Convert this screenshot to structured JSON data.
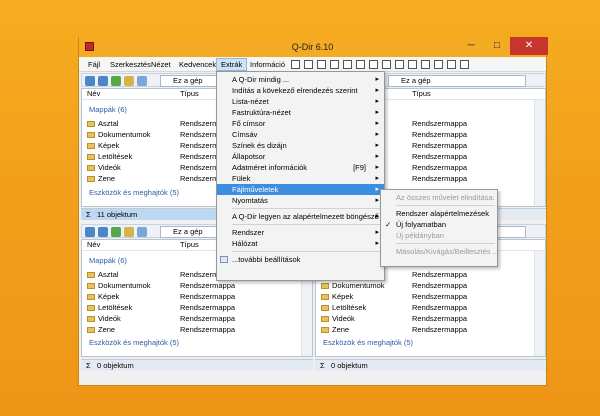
{
  "window": {
    "title": "Q-Dir 6.10"
  },
  "menubar": [
    "Fájl",
    "Szerkesztés",
    "Nézet",
    "Kedvencek",
    "Extrák",
    "Információ"
  ],
  "address": "Ez a gép",
  "columns": {
    "name": "Név",
    "type": "Típus"
  },
  "group_folders": "Mappák (6)",
  "group_devices": "Eszközök és meghajtók (5)",
  "folders": [
    "Asztal",
    "Dokumentumok",
    "Képek",
    "Letöltések",
    "Videók",
    "Zene"
  ],
  "folder_type": "Rendszermappa",
  "status": {
    "tl": "11 objektum",
    "bl": "0 objektum",
    "br": "0 objektum"
  },
  "extras_menu": {
    "items": [
      {
        "label": "A Q-Dir mindig ...",
        "arrow": true
      },
      {
        "label": "Indítás a kövekező elrendezés szerint",
        "arrow": true
      },
      {
        "label": "Lista-nézet",
        "arrow": true
      },
      {
        "label": "Fastruktúra-nézet",
        "arrow": true
      },
      {
        "label": "Fő címsor",
        "arrow": true
      },
      {
        "label": "Címsáv",
        "arrow": true
      },
      {
        "label": "Színek és dizájn",
        "arrow": true
      },
      {
        "label": "Állapotsor",
        "arrow": true
      },
      {
        "label": "Adatméret információk",
        "key": "[F9]",
        "arrow": true
      },
      {
        "label": "Fülek",
        "arrow": true
      },
      {
        "label": "Fájlműveletek",
        "arrow": true,
        "highlight": true
      },
      {
        "label": "Nyomtatás",
        "arrow": true
      },
      {
        "sep": true
      },
      {
        "label": "A Q-Dir legyen az alapértelmezett böngésző",
        "arrow": true
      },
      {
        "sep": true
      },
      {
        "label": "Rendszer",
        "arrow": true
      },
      {
        "label": "Hálózat",
        "arrow": true
      },
      {
        "sep": true
      },
      {
        "label": "...további beállítások",
        "icon": true
      }
    ]
  },
  "file_ops_menu": {
    "items": [
      {
        "label": "Az összes művelet elindítása:",
        "disabled": true
      },
      {
        "sep": true
      },
      {
        "label": "Rendszer alapértelmezések"
      },
      {
        "label": "Új folyamatban",
        "checked": true
      },
      {
        "label": "Új példányban",
        "disabled": true
      },
      {
        "sep": true
      },
      {
        "label": "Másolás/Kivágás/Beillesztés ...",
        "disabled": true
      }
    ]
  }
}
